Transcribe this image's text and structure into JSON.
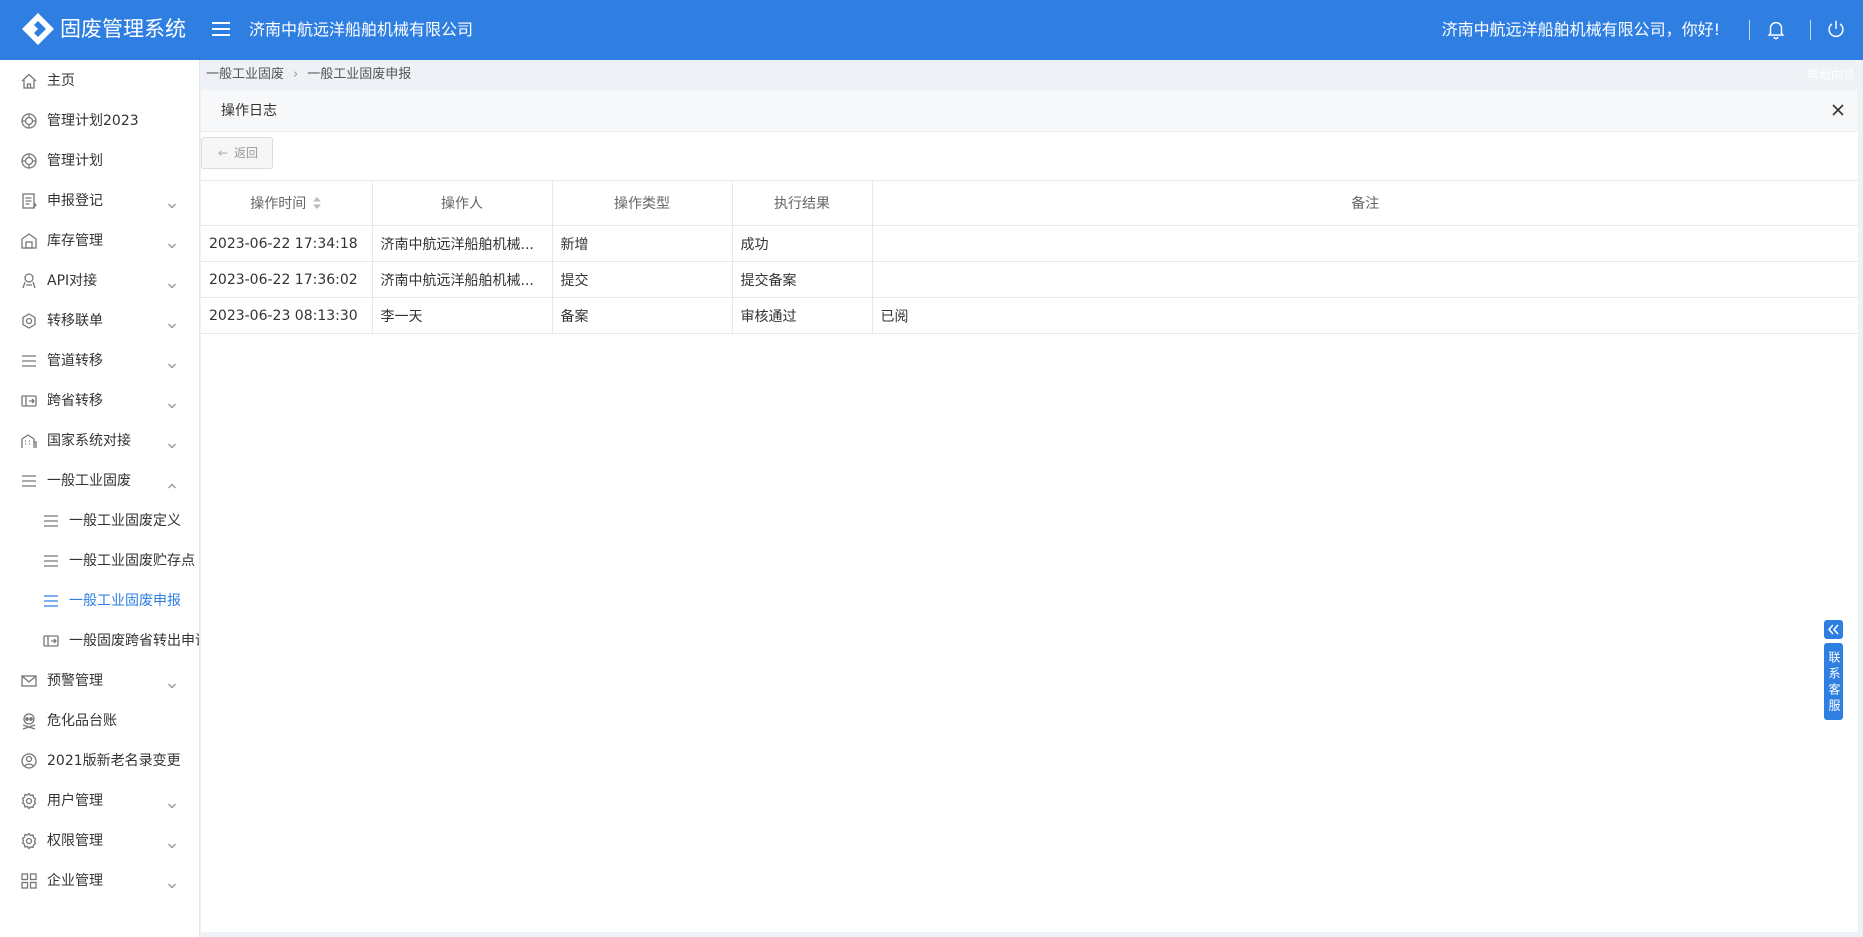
{
  "app": {
    "title": "固废管理系统",
    "company": "济南中航远洋船舶机械有限公司",
    "greeting": "济南中航远洋船舶机械有限公司，你好!"
  },
  "colors": {
    "primary": "#2f7fe3",
    "sidebar_bg": "#ffffff",
    "text": "#333333"
  },
  "sidebar": {
    "items": [
      {
        "label": "主页",
        "icon": "home-icon"
      },
      {
        "label": "管理计划2023",
        "icon": "plan-icon"
      },
      {
        "label": "管理计划",
        "icon": "plan-icon"
      },
      {
        "label": "申报登记",
        "icon": "document-icon",
        "expandable": true
      },
      {
        "label": "库存管理",
        "icon": "warehouse-icon",
        "expandable": true
      },
      {
        "label": "API对接",
        "icon": "api-icon",
        "expandable": true
      },
      {
        "label": "转移联单",
        "icon": "transfer-icon",
        "expandable": true
      },
      {
        "label": "管道转移",
        "icon": "list-icon",
        "expandable": true
      },
      {
        "label": "跨省转移",
        "icon": "ticket-icon",
        "expandable": true
      },
      {
        "label": "国家系统对接",
        "icon": "building-icon",
        "expandable": true
      },
      {
        "label": "一般工业固废",
        "icon": "list-icon",
        "expandable": true,
        "expanded": true
      },
      {
        "label": "一般工业固废定义",
        "icon": "list-icon",
        "sub": true
      },
      {
        "label": "一般工业固废贮存点",
        "icon": "list-icon",
        "sub": true
      },
      {
        "label": "一般工业固废申报",
        "icon": "list-icon",
        "sub": true,
        "active": true
      },
      {
        "label": "一般固废跨省转出申请",
        "icon": "ticket-icon",
        "sub": true
      },
      {
        "label": "预警管理",
        "icon": "mail-icon",
        "expandable": true
      },
      {
        "label": "危化品台账",
        "icon": "skull-icon"
      },
      {
        "label": "2021版新老名录变更",
        "icon": "badge-icon"
      },
      {
        "label": "用户管理",
        "icon": "gear-icon",
        "expandable": true
      },
      {
        "label": "权限管理",
        "icon": "gear-icon",
        "expandable": true
      },
      {
        "label": "企业管理",
        "icon": "grid-icon",
        "expandable": true
      }
    ]
  },
  "breadcrumb": {
    "level1": "一般工业固废",
    "level2": "一般工业固废申报"
  },
  "help_guide": "帮助向导",
  "panel": {
    "title": "操作日志",
    "back_label": "返回",
    "table": {
      "columns": [
        "操作时间",
        "操作人",
        "操作类型",
        "执行结果",
        "备注"
      ],
      "rows": [
        [
          "2023-06-22 17:34:18",
          "济南中航远洋船舶机械...",
          "新增",
          "成功",
          ""
        ],
        [
          "2023-06-22 17:36:02",
          "济南中航远洋船舶机械...",
          "提交",
          "提交备案",
          ""
        ],
        [
          "2023-06-23 08:13:30",
          "李一天",
          "备案",
          "审核通过",
          "已阅"
        ]
      ]
    }
  },
  "customer_service": {
    "label": "联系客服"
  }
}
